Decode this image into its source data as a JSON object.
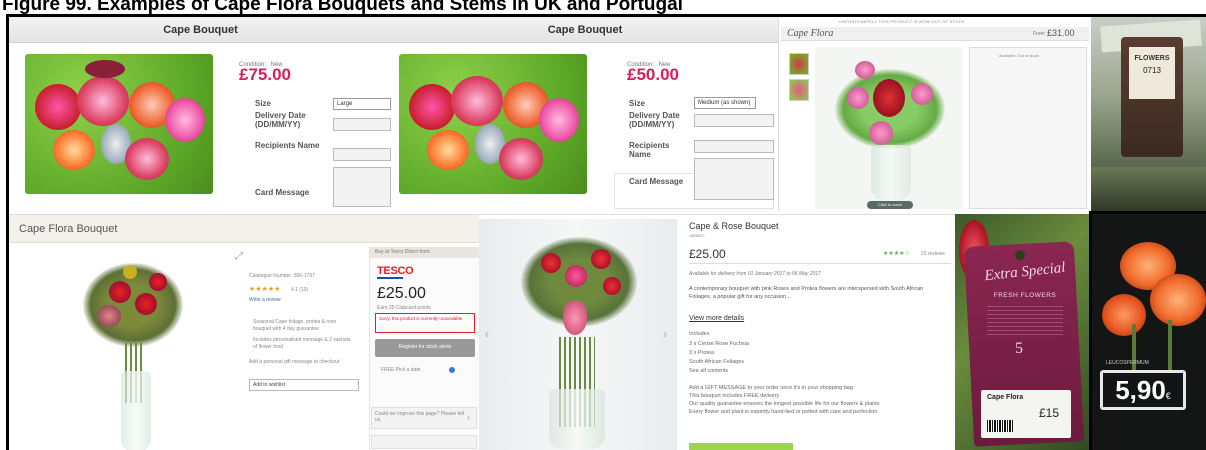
{
  "figure_title": "Figure 99. Examples of Cape Flora Bouquets and Stems in UK and Portugal",
  "panel_a": {
    "header": "Cape Bouquet",
    "condition_label": "Condition:",
    "condition_value": "New",
    "price": "£75.00",
    "size_label": "Size",
    "size_value": "Large",
    "delivery_label": "Delivery Date (DD/MM/YY)",
    "recipients_label": "Recipients Name",
    "card_label": "Card Message"
  },
  "panel_b": {
    "header": "Cape Bouquet",
    "condition_label": "Condition:",
    "condition_value": "New",
    "price": "£50.00",
    "size_label": "Size",
    "size_value": "Medium (as shown)",
    "delivery_label": "Delivery Date (DD/MM/YY)",
    "recipients_label": "Recipients Name",
    "card_label": "Card Message"
  },
  "panel_c": {
    "notice": "UNFORTUNATELY THIS PRODUCT IS NOW OUT OF STOCK",
    "title": "Cape Flora",
    "from_label": "From",
    "price": "£31.00",
    "zoom_label": "Click to zoom",
    "availability": "Available: Out of stock"
  },
  "panel_d": {
    "stem_brand": "FLOWERS",
    "stem_code": "0713"
  },
  "panel_e": {
    "header": "Cape Flora Bouquet",
    "catalogue": "Catalogue Number: 306-1797",
    "stars": "★★★★★",
    "rating": "4.1 (19)",
    "write_review": "Write a review",
    "bullets": [
      "Seasonal Cape foliage, protea & rose bouquet with 4 day guarantee",
      "Includes personalised message & 2 sachets of flower food"
    ],
    "gift_message": "Add a personal gift message at checkout",
    "wishlist_label": "Add to wishlist",
    "buy_label": "Buy at Tesco Direct from:",
    "retailer": "TESCO",
    "price": "£25.00",
    "points": "Earn 25 Clubcard points",
    "unavailable": "Sorry, this product is currently unavailable",
    "register_button": "Register for stock alerts",
    "pick_label": "FREE Pick a date",
    "feedback": "Could we improve this page? Please tell us."
  },
  "panel_f": {
    "title": "Cape & Rose Bouquet",
    "code": "XBBBS2",
    "price": "£25.00",
    "stars": "★★★★☆",
    "reviews": "23 reviews",
    "availability": "Available for delivery from 01 January 2017 to 06 May 2017",
    "description": "A contemporary bouquet with pink Roses and Protea flowers are interspersed with South African Foliages, a popular gift for any occasion...",
    "view_more": "View more details",
    "includes_title": "Includes",
    "includes": [
      "3 x Cerise Rose Fuchsia",
      "3 x Protea",
      "South African Foliages",
      "See all contents"
    ],
    "gift_lines": [
      "Add a GIFT MESSAGE to your order once it's in your shopping bag",
      "This bouquet includes FREE delivery",
      "Our quality guarantee ensures the longest possible life for our flowers & plants",
      "Every flower and plant is expertly hand-tied or potted with care and perfection"
    ]
  },
  "panel_g": {
    "tag_script": "Extra Special",
    "tag_caps": "FRESH FLOWERS",
    "tag_number": "5",
    "product": "Cape Flora",
    "price": "£15"
  },
  "panel_h": {
    "price": "5,90",
    "currency": "€",
    "shelf_label": "LEUCOSPERMUM"
  },
  "colors": {
    "pink_price": "#d6205f",
    "tesco_red": "#e31c2d",
    "tesco_blue": "#1d4f9b",
    "green_button": "#9bd64b",
    "tag_purple": "#7a1f48"
  }
}
